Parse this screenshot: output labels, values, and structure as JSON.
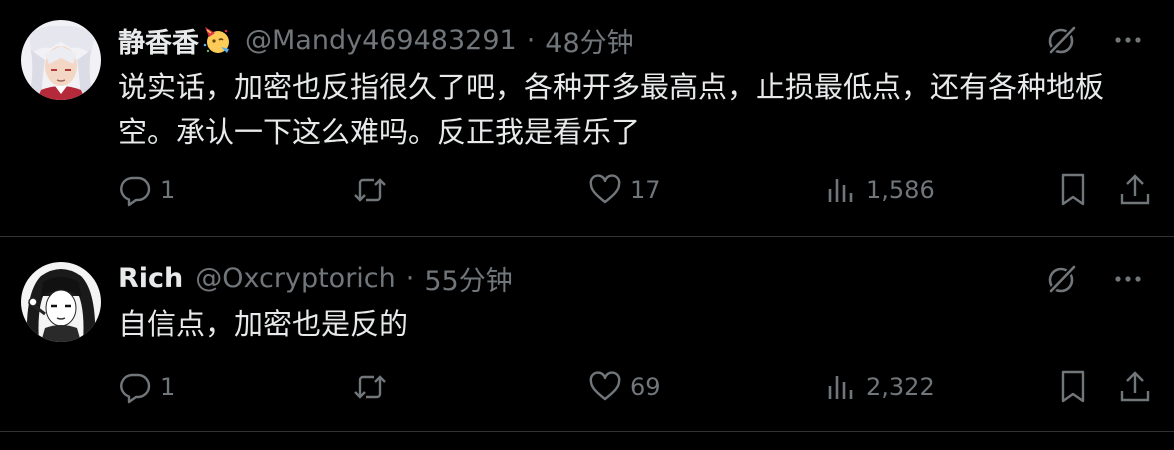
{
  "tweets": [
    {
      "display_name": "静香香",
      "badge_emoji": "party-face-emoji",
      "handle": "@Mandy469483291",
      "separator": "·",
      "time": "48分钟",
      "text_line1": "说实话，加密也反指很久了吧，各种开多最高点，止损最低点，还有各种地板",
      "text_line2": "空。承认一下这么难吗。反正我是看乐了",
      "replies": "1",
      "retweets": "",
      "likes": "17",
      "views": "1,586"
    },
    {
      "display_name": "Rich",
      "handle": "@Oxcryptorich",
      "separator": "·",
      "time": "55分钟",
      "text_line1": "自信点，加密也是反的",
      "replies": "1",
      "retweets": "",
      "likes": "69",
      "views": "2,322"
    }
  ],
  "icons": {
    "top": [
      "grok-icon",
      "more-icon"
    ],
    "actions": [
      "reply-icon",
      "retweet-icon",
      "like-icon",
      "views-icon",
      "bookmark-icon",
      "share-icon"
    ]
  },
  "colors": {
    "background": "#000000",
    "text_primary": "#e7e9ea",
    "text_secondary": "#71767b",
    "divider": "#2f3336"
  }
}
